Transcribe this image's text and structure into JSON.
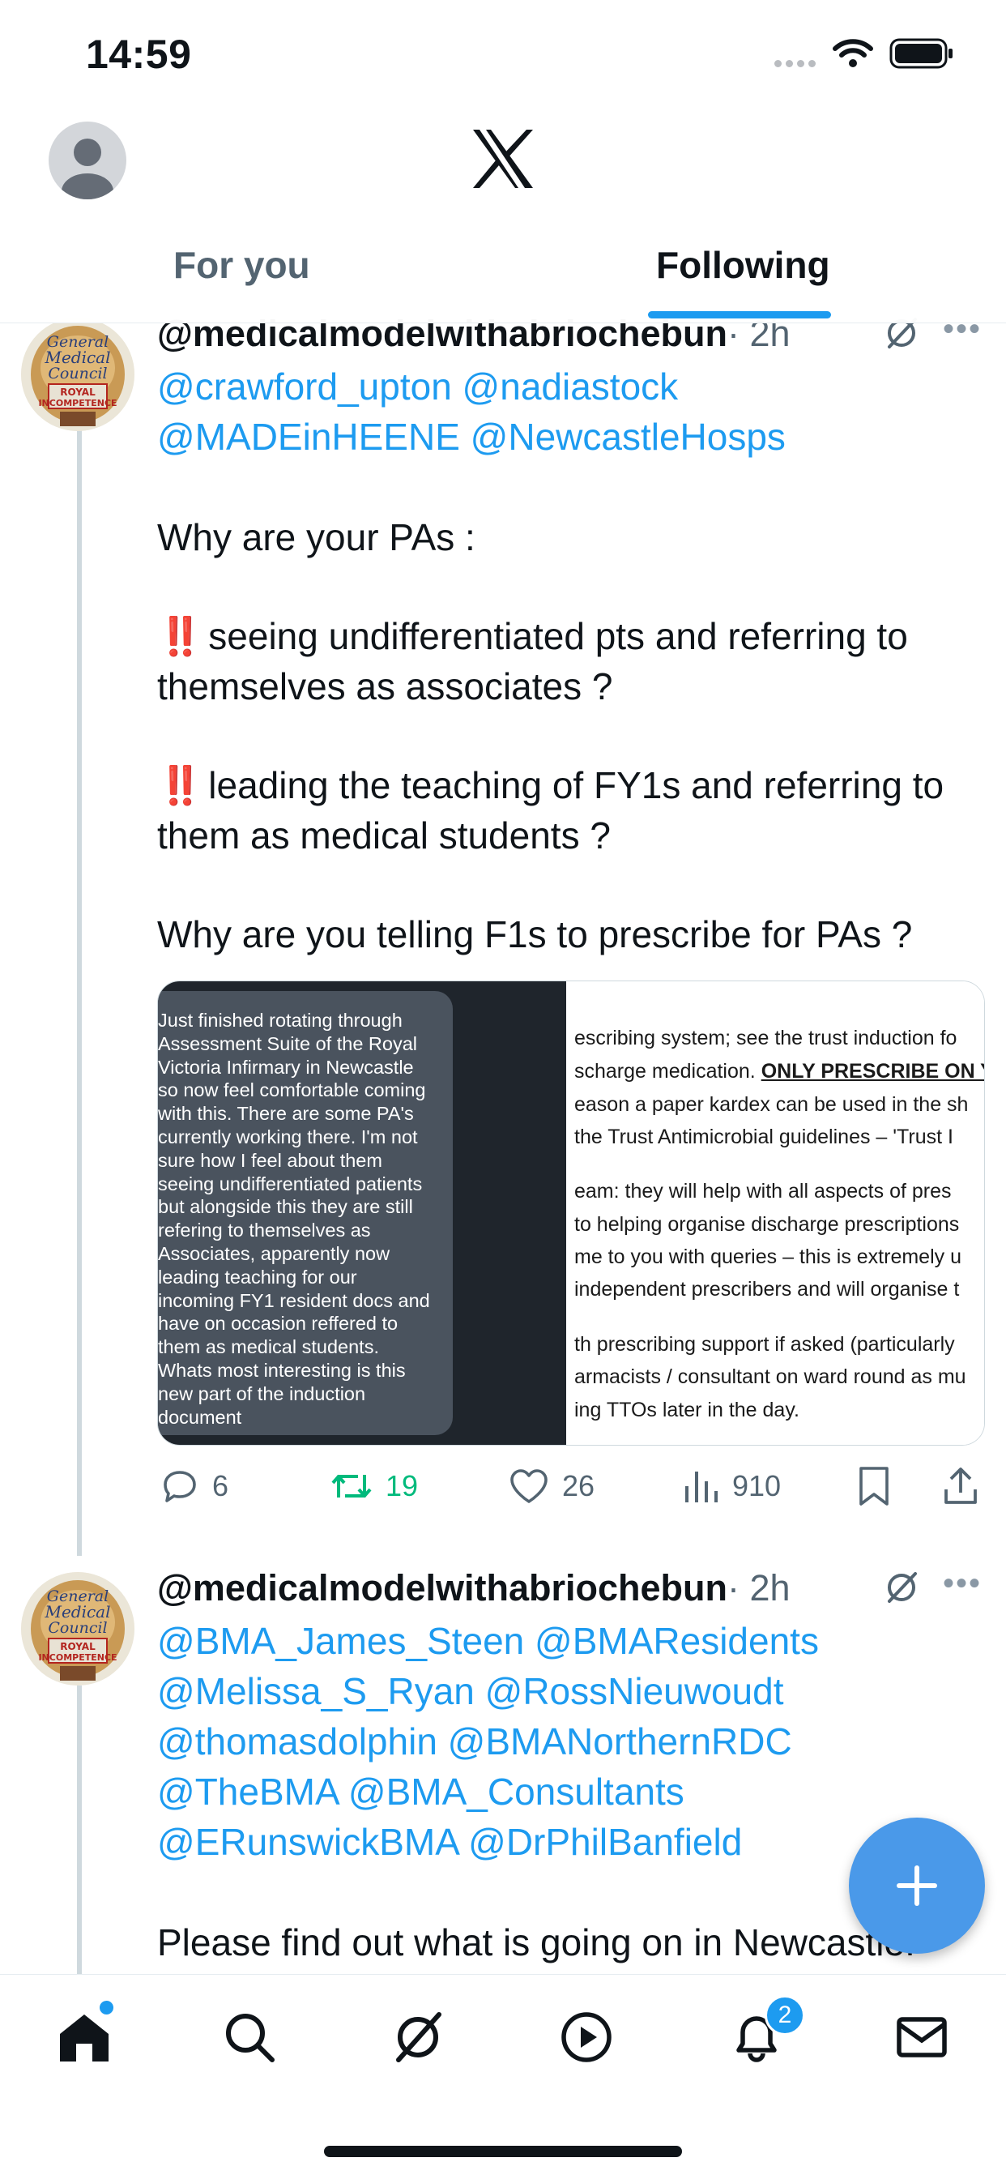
{
  "status_bar": {
    "time": "14:59"
  },
  "header": {
    "logo": "x-logo-icon",
    "tabs": [
      {
        "label": "For you",
        "active": false
      },
      {
        "label": "Following",
        "active": true
      }
    ],
    "accent_color": "#1d9bf0"
  },
  "posts": [
    {
      "handle": "@medicalmodelwithabriochebun",
      "time": "· 2h",
      "mention_lines": [
        "@crawford_upton @nadiastock",
        "@MADEinHEENE @NewcastleHosps"
      ],
      "body_lines": [
        "Why are your PAs :",
        "seeing undifferentiated pts and referring to",
        "themselves as associates ?",
        "leading the teaching of  FY1s and referring to",
        "them as medical students ?",
        "Why are you telling F1s to prescribe for PAs ?"
      ],
      "emphasis": "‼️",
      "media": {
        "left_text_lines": [
          "Just finished rotating through",
          "Assessment Suite of the Royal",
          "Victoria Infirmary in Newcastle",
          "so now feel comfortable coming",
          "with this. There are some PA's",
          "currently working there. I'm not",
          "sure how I feel about them",
          "seeing undifferentiated patients",
          "but alongside this they are still",
          "refering to themselves as",
          "Associates, apparently now",
          "leading teaching for our",
          "incoming FY1 resident docs and",
          "have on occasion reffered to",
          "them as medical students.",
          "Whats most interesting is this",
          "new part of the induction",
          "document"
        ],
        "right_doc_lines": [
          "escribing system; see the trust induction fo",
          "scharge medication. ",
          "eason a paper kardex can be used in the sh",
          " the Trust Antimicrobial guidelines – 'Trust I",
          "eam: they will help with all aspects of pres",
          " to helping organise discharge prescriptions",
          "me to you with queries – this is extremely u",
          " independent prescribers and will organise t",
          "th prescribing support if asked (particularly",
          "armacists / consultant on ward round as mu",
          "ing TTOs later in the day."
        ],
        "right_doc_emphasis": "ONLY PRESCRIBE ON Y"
      },
      "actions": {
        "replies": "6",
        "reposts": "19",
        "likes": "26",
        "views": "910"
      },
      "repost_color": "#00ba7c"
    },
    {
      "handle": "@medicalmodelwithabriochebun",
      "time": "· 2h",
      "mention_lines": [
        "@BMA_James_Steen @BMAResidents",
        "@Melissa_S_Ryan @RossNieuwoudt",
        "@thomasdolphin @BMANorthernRDC",
        "@TheBMA @BMA_Consultants",
        "@ERunswickBMA @DrPhilBanfield"
      ],
      "body_lines": [
        "Please find out what is going on in Newcastle."
      ]
    }
  ],
  "fab": {
    "icon": "plus-icon"
  },
  "tab_bar": {
    "items": [
      "home-icon",
      "search-icon",
      "grok-icon",
      "play-icon",
      "bell-icon",
      "mail-icon"
    ],
    "notifications_badge": "2"
  }
}
